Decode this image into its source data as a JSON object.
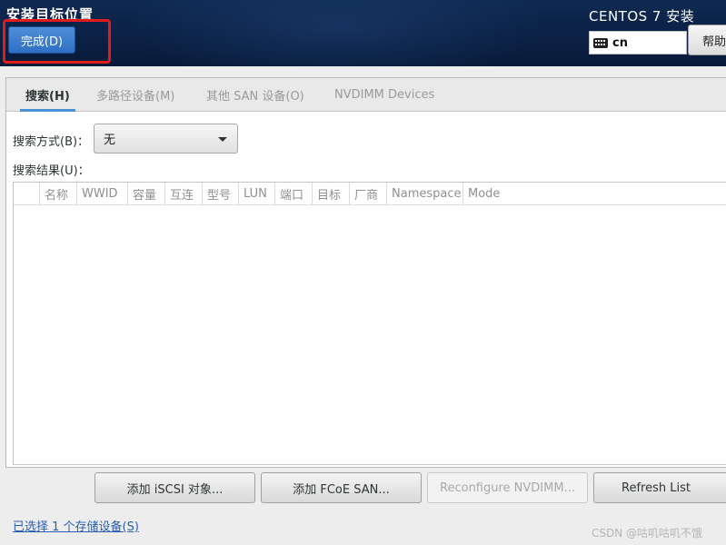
{
  "header": {
    "page_title": "安装目标位置",
    "done_label": "完成(D)",
    "product_title": "CENTOS 7 安装",
    "keyboard_layout": "cn",
    "help_label": "帮助！",
    "highlight_color": "#e21b1b"
  },
  "tabs": [
    {
      "label": "搜索(H)",
      "active": true
    },
    {
      "label": "多路径设备(M)",
      "active": false
    },
    {
      "label": "其他 SAN 设备(O)",
      "active": false
    },
    {
      "label": "NVDIMM Devices",
      "active": false
    }
  ],
  "search": {
    "mode_label": "搜索方式(B)：",
    "mode_value": "无",
    "results_label": "搜索结果(U)："
  },
  "table": {
    "columns": [
      "名称",
      "WWID",
      "容量",
      "互连",
      "型号",
      "LUN",
      "端口",
      "目标",
      "厂商",
      "Namespace",
      "Mode"
    ],
    "rows": []
  },
  "buttons": {
    "add_iscsi": "添加 iSCSI 对象...",
    "add_fcoe": "添加 FCoE SAN...",
    "reconfigure_nvdimm": "Reconfigure NVDIMM...",
    "refresh_list": "Refresh List"
  },
  "footer": {
    "selected_link": "已选择 1 个存储设备(S)",
    "watermark": "CSDN @咕叽咕叽不饿"
  },
  "colors": {
    "header_bg": "#0c2247",
    "accent": "#4a90d9",
    "link": "#2a5db0"
  }
}
